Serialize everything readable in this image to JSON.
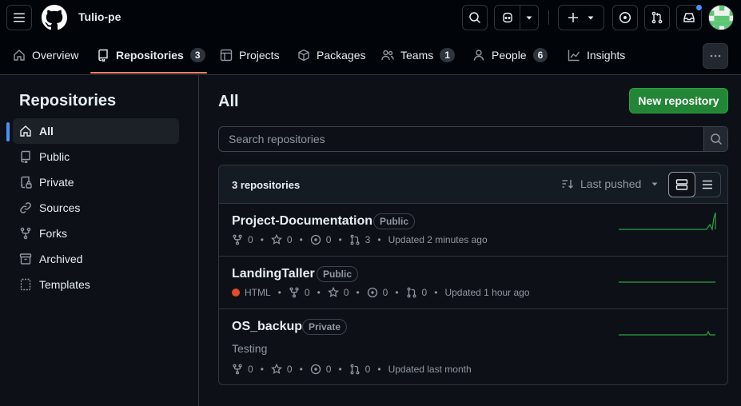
{
  "header": {
    "org_name": "Tulio-pe"
  },
  "nav": {
    "tabs": [
      {
        "label": "Overview"
      },
      {
        "label": "Repositories",
        "count": "3"
      },
      {
        "label": "Projects"
      },
      {
        "label": "Packages"
      },
      {
        "label": "Teams",
        "count": "1"
      },
      {
        "label": "People",
        "count": "6"
      },
      {
        "label": "Insights"
      }
    ]
  },
  "sidebar": {
    "title": "Repositories",
    "items": [
      {
        "label": "All"
      },
      {
        "label": "Public"
      },
      {
        "label": "Private"
      },
      {
        "label": "Sources"
      },
      {
        "label": "Forks"
      },
      {
        "label": "Archived"
      },
      {
        "label": "Templates"
      }
    ]
  },
  "main": {
    "title": "All",
    "new_button": "New repository",
    "search_placeholder": "Search repositories",
    "count_label": "3 repositories",
    "sort_label": "Last pushed",
    "repos": [
      {
        "name": "Project-Documentation",
        "visibility": "Public",
        "forks": "0",
        "stars": "0",
        "issues": "0",
        "prs": "3",
        "updated": "Updated 2 minutes ago"
      },
      {
        "name": "LandingTaller",
        "visibility": "Public",
        "language": "HTML",
        "forks": "0",
        "stars": "0",
        "issues": "0",
        "prs": "0",
        "updated": "Updated 1 hour ago"
      },
      {
        "name": "OS_backup",
        "visibility": "Private",
        "description": "Testing",
        "forks": "0",
        "stars": "0",
        "issues": "0",
        "prs": "0",
        "updated": "Updated last month"
      }
    ]
  },
  "colors": {
    "accent_green": "#238636",
    "tab_underline": "#f78166",
    "html_lang": "#e34c26",
    "notification": "#4493f8"
  }
}
